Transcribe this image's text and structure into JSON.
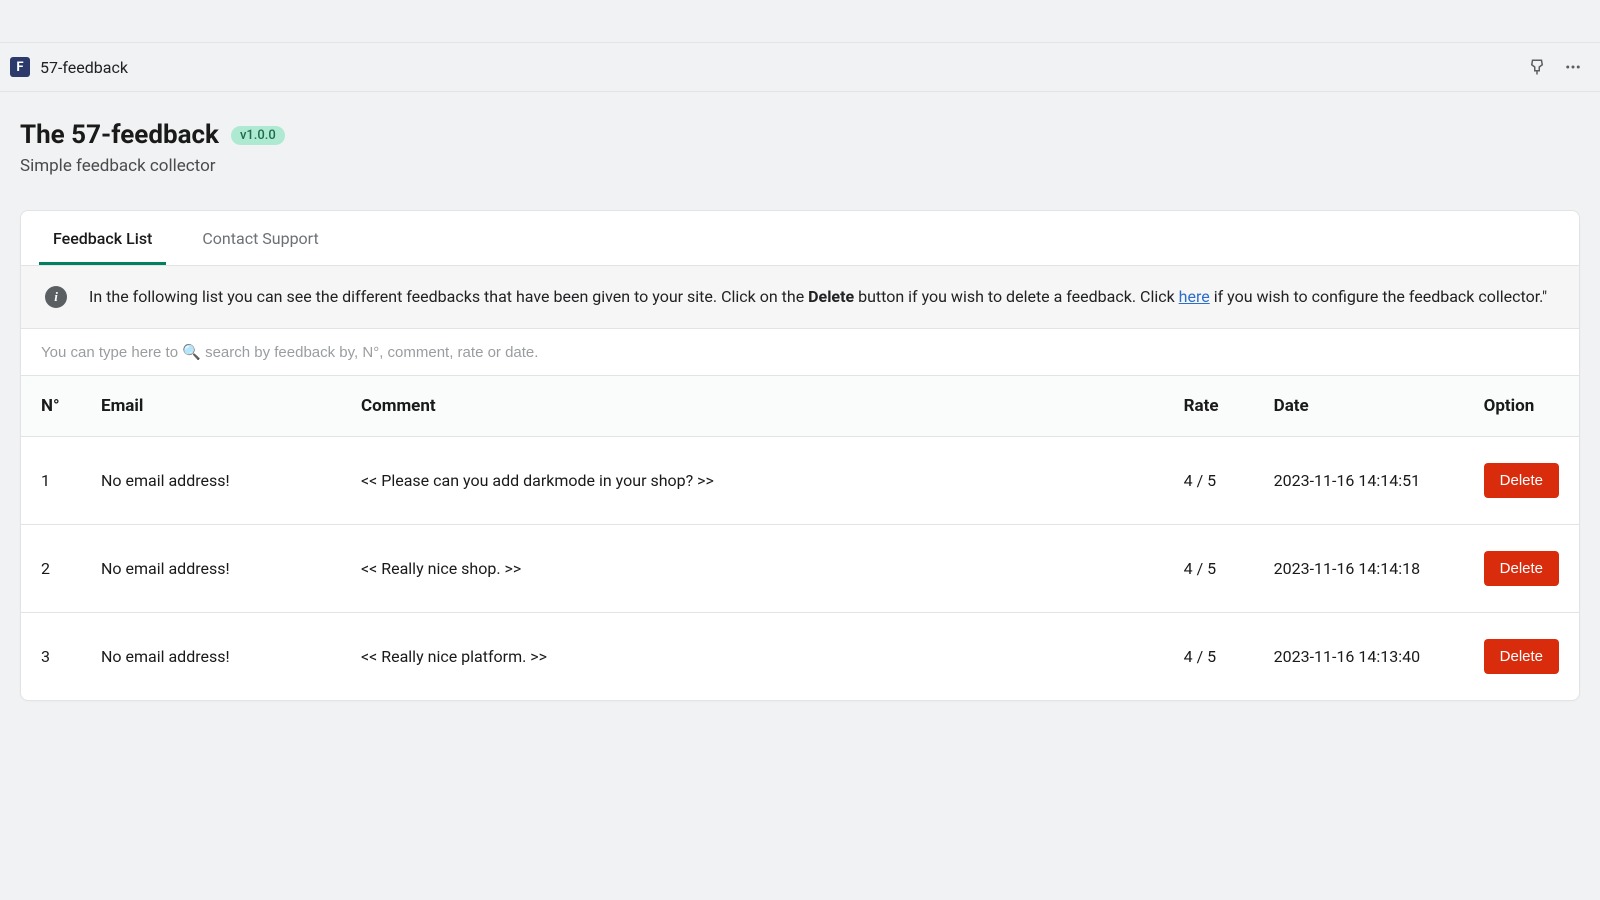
{
  "topbar": {
    "app_icon_letter": "F",
    "app_name": "57-feedback"
  },
  "header": {
    "title": "The 57-feedback",
    "version": "v1.0.0",
    "subtitle": "Simple feedback collector"
  },
  "tabs": [
    {
      "label": "Feedback List",
      "active": true
    },
    {
      "label": "Contact Support",
      "active": false
    }
  ],
  "info": {
    "text_before_bold": "In the following list you can see the different feedbacks that have been given to your site. Click on the ",
    "bold": "Delete",
    "text_after_bold": " button if you wish to delete a feedback. Click ",
    "link": "here",
    "text_after_link": " if you wish to configure the feedback collector.\""
  },
  "search": {
    "placeholder": "You can type here to 🔍 search by feedback by, N°, comment, rate or date."
  },
  "table": {
    "columns": [
      "N°",
      "Email",
      "Comment",
      "Rate",
      "Date",
      "Option"
    ],
    "delete_label": "Delete",
    "rows": [
      {
        "num": "1",
        "email": "No email address!",
        "comment": "<< Please can you add darkmode in your shop? >>",
        "rate": "4 / 5",
        "date": "2023-11-16 14:14:51"
      },
      {
        "num": "2",
        "email": "No email address!",
        "comment": "<< Really nice shop. >>",
        "rate": "4 / 5",
        "date": "2023-11-16 14:14:18"
      },
      {
        "num": "3",
        "email": "No email address!",
        "comment": "<< Really nice platform. >>",
        "rate": "4 / 5",
        "date": "2023-11-16 14:13:40"
      }
    ]
  }
}
